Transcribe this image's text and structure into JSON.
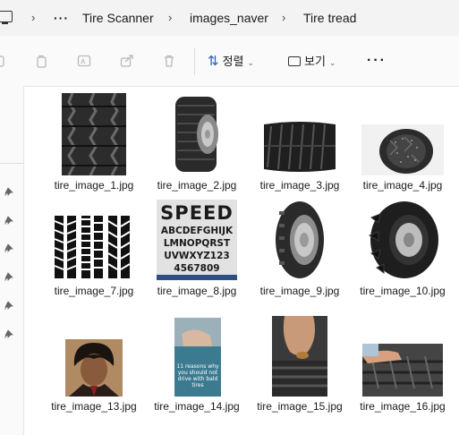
{
  "breadcrumb": {
    "items": [
      "Tire Scanner",
      "images_naver",
      "Tire tread"
    ],
    "overflow_label": "···"
  },
  "toolbar": {
    "sort_label": "정렬",
    "view_label": "보기",
    "more_label": "···"
  },
  "files": [
    "tire_image_1.jpg",
    "tire_image_2.jpg",
    "tire_image_3.jpg",
    "tire_image_4.jpg",
    "tire_image_7.jpg",
    "tire_image_8.jpg",
    "tire_image_9.jpg",
    "tire_image_10.jpg",
    "tire_image_13.jpg",
    "tire_image_14.jpg",
    "tire_image_15.jpg",
    "tire_image_16.jpg"
  ],
  "thumb_text": {
    "speed_word": "SPEED",
    "alphabet_1": "ABCDEFGHIJK",
    "alphabet_2": "LMNOPQRST",
    "alphabet_3": "UVWXYZ123",
    "alphabet_4": "4567809",
    "poster_line_1": "11 reasons why",
    "poster_line_2": "you should not",
    "poster_line_3": "drive with bald",
    "poster_line_4": "tires"
  }
}
